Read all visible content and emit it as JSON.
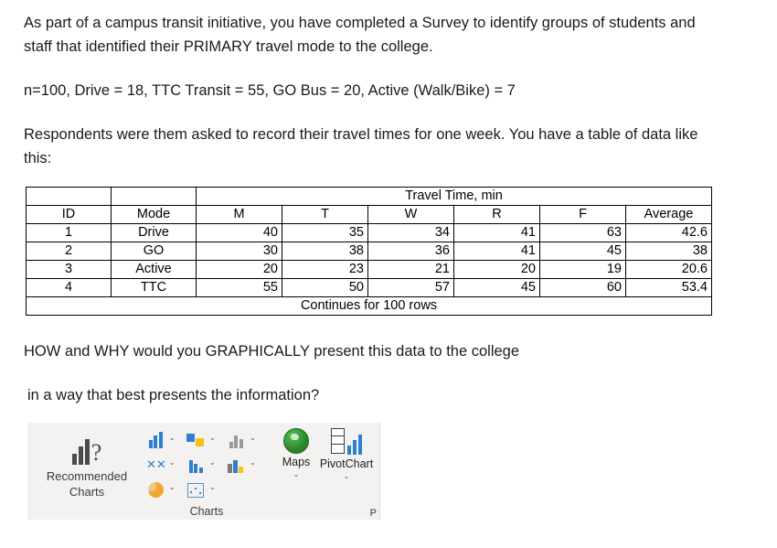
{
  "body": {
    "para1": "As part of a campus transit initiative, you have completed a Survey to identify groups of students and staff that identified their PRIMARY travel mode to the college.",
    "para2": "n=100,  Drive = 18, TTC Transit = 55, GO Bus = 20, Active (Walk/Bike) = 7",
    "para3": "Respondents were them asked to record their travel times for one week.  You have a table of data like this:",
    "question1": "HOW and WHY would you GRAPHICALLY present this data to the college",
    "question2": "in a way that best presents the information?"
  },
  "table": {
    "group_header": "Travel Time, min",
    "headers": [
      "ID",
      "Mode",
      "M",
      "T",
      "W",
      "R",
      "F",
      "Average"
    ],
    "rows": [
      [
        "1",
        "Drive",
        "40",
        "35",
        "34",
        "41",
        "63",
        "42.6"
      ],
      [
        "2",
        "GO",
        "30",
        "38",
        "36",
        "41",
        "45",
        "38"
      ],
      [
        "3",
        "Active",
        "20",
        "23",
        "21",
        "20",
        "19",
        "20.6"
      ],
      [
        "4",
        "TTC",
        "55",
        "50",
        "57",
        "45",
        "60",
        "53.4"
      ]
    ],
    "footer": "Continues for 100 rows"
  },
  "ribbon": {
    "recommended_charts": {
      "label_line1": "Recommended",
      "label_line2": "Charts",
      "icon": "recommended-charts-icon"
    },
    "charts_group_label": "Charts",
    "chart_buttons": [
      {
        "name": "column-chart-icon",
        "caret": "⌄"
      },
      {
        "name": "waterfall-chart-icon",
        "caret": "⌄"
      },
      {
        "name": "hierarchy-chart-icon",
        "caret": "⌄"
      },
      {
        "name": "scatter-chart-icon",
        "caret": "⌄"
      },
      {
        "name": "statistic-chart-icon",
        "caret": "⌄"
      },
      {
        "name": "combo-chart-icon",
        "caret": "⌄"
      },
      {
        "name": "pie-chart-icon",
        "caret": "⌄"
      },
      {
        "name": "sparkline-chart-icon",
        "caret": "⌄"
      }
    ],
    "maps": {
      "label": "Maps",
      "caret": "⌄",
      "icon": "globe-icon"
    },
    "pivotchart": {
      "label": "PivotChart",
      "caret": "⌄",
      "icon": "pivotchart-icon"
    },
    "right_tag": "P"
  }
}
